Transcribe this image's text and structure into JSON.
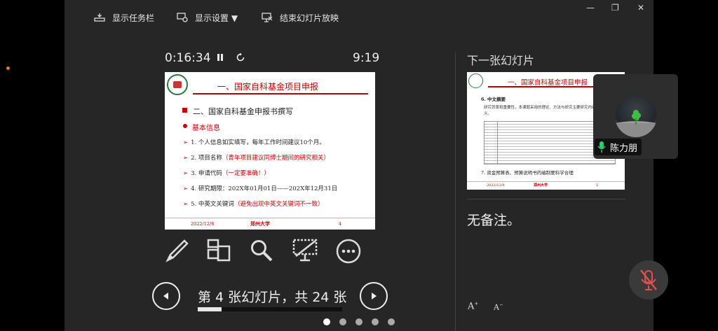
{
  "toolbar": {
    "show_taskbar": "显示任务栏",
    "display_settings": "显示设置 ▼",
    "end_slideshow": "结束幻灯片放映",
    "minimize": "—",
    "restore": "❐",
    "close": "✕"
  },
  "timer": {
    "elapsed": "0:16:34",
    "clock": "9:19"
  },
  "current_slide": {
    "title": "一、国家自科基金项目申报",
    "heading": "二、国家自科基金申报书撰写",
    "section": "基本信息",
    "items": [
      {
        "text": "1. 个人信息如实填写，每年工作时间建议10个月。",
        "note": ""
      },
      {
        "text": "2. 项目名称",
        "note": "（青年项目建议同博士期间的研究相关）"
      },
      {
        "text": "3. 申请代码",
        "note": "（一定要准确！）"
      },
      {
        "text": "4. 研究期限：202X年01月01日——202X年12月31日",
        "note": ""
      },
      {
        "text": "5. 中英文关键词",
        "note": "（避免出现中英文关键词不一致）"
      }
    ],
    "footer_date": "2022/12/8",
    "footer_university": "郑州大学",
    "footer_page": "4"
  },
  "navigation": {
    "counter": "第 4 张幻灯片，共 24 张",
    "current": 4,
    "total": 24
  },
  "next_slide": {
    "label": "下一张幻灯片",
    "title": "一、国家自科基金项目申报",
    "heading": "6. 中文摘要",
    "text": "研究背景和重要性，本课题采用的理论、方法与研究主要研究内容，研究意义。",
    "item7": "7. 资金预算表、预算说明书的编制要科学合理",
    "footer_date": "2022/12/8",
    "footer_university": "郑州大学",
    "footer_page": "5"
  },
  "notes": {
    "text": "无备注。"
  },
  "font_controls": {
    "increase": "A",
    "decrease": "A"
  },
  "participant": {
    "name": "陈力朋"
  },
  "page_dots": {
    "count": 5,
    "active": 0
  },
  "colors": {
    "accent_red": "#c00000",
    "mic_green": "#2ecc71",
    "background": "#262626"
  },
  "icons": [
    "taskbar-icon",
    "display-settings-icon",
    "end-slideshow-icon",
    "pause-icon",
    "restart-icon",
    "pen-icon",
    "all-slides-icon",
    "zoom-icon",
    "black-screen-icon",
    "more-icon",
    "previous-icon",
    "next-icon",
    "microphone-icon",
    "mic-muted-icon"
  ]
}
